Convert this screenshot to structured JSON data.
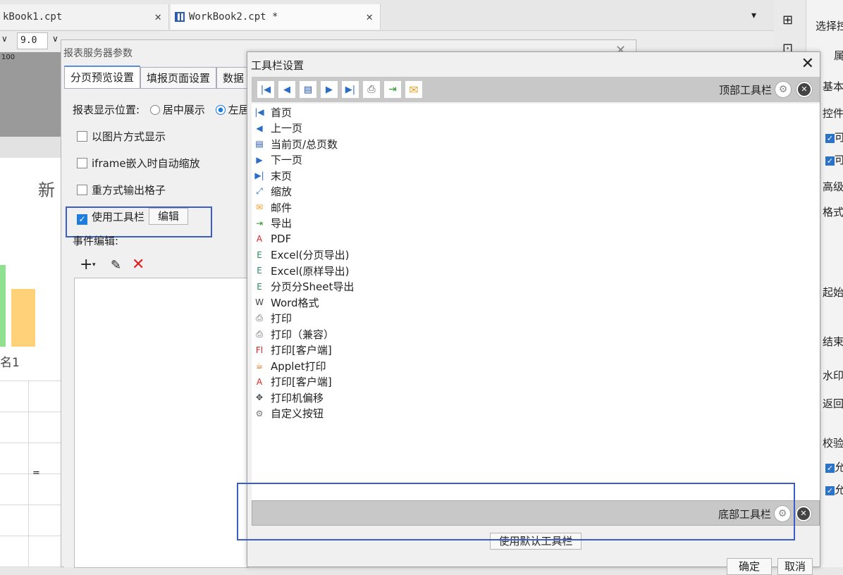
{
  "tabs": [
    {
      "label": "kBook1.cpt"
    },
    {
      "label": "WorkBook2.cpt *"
    }
  ],
  "ribbon": {
    "font_size": "9.0",
    "ruler": "100"
  },
  "right_panel": {
    "header": "选择控",
    "items": [
      "属",
      "基本",
      "控件",
      "可",
      "可",
      "高级",
      "格式",
      "起始",
      "结束",
      "水印",
      "返回",
      "校验",
      "允",
      "允"
    ]
  },
  "sheet": {
    "title_fragment": "新",
    "label": "名1",
    "cell": "="
  },
  "report_dialog": {
    "title": "报表服务器参数",
    "tabs": [
      "分页预览设置",
      "填报页面设置",
      "数据"
    ],
    "display_position_label": "报表显示位置:",
    "radio_center": "居中展示",
    "radio_left": "左居",
    "opt_image": "以图片方式显示",
    "opt_iframe": "iframe嵌入时自动缩放",
    "opt_repeat": "重方式输出格子",
    "opt_toolbar": "使用工具栏",
    "edit_button": "编辑",
    "event_label": "事件编辑:"
  },
  "toolbar_dialog": {
    "title": "工具栏设置",
    "top_toolbar": "顶部工具栏",
    "bottom_toolbar": "底部工具栏",
    "use_default": "使用默认工具栏",
    "ok": "确定",
    "cancel": "取消",
    "items": [
      {
        "label": "首页",
        "icon": "first-page-icon"
      },
      {
        "label": "上一页",
        "icon": "prev-page-icon"
      },
      {
        "label": "当前页/总页数",
        "icon": "page-count-icon"
      },
      {
        "label": "下一页",
        "icon": "next-page-icon"
      },
      {
        "label": "末页",
        "icon": "last-page-icon"
      },
      {
        "label": "缩放",
        "icon": "zoom-icon"
      },
      {
        "label": "邮件",
        "icon": "mail-icon"
      },
      {
        "label": "导出",
        "icon": "export-icon"
      },
      {
        "label": "PDF",
        "icon": "pdf-icon"
      },
      {
        "label": "Excel(分页导出)",
        "icon": "excel-icon"
      },
      {
        "label": "Excel(原样导出)",
        "icon": "excel-icon"
      },
      {
        "label": "分页分Sheet导出",
        "icon": "excel-icon"
      },
      {
        "label": "Word格式",
        "icon": "word-icon"
      },
      {
        "label": "打印",
        "icon": "print-icon"
      },
      {
        "label": "打印（兼容）",
        "icon": "print-icon"
      },
      {
        "label": "打印[客户端]",
        "icon": "flash-print-icon"
      },
      {
        "label": "Applet打印",
        "icon": "applet-icon"
      },
      {
        "label": "打印[客户端]",
        "icon": "pdf-print-icon"
      },
      {
        "label": "打印机偏移",
        "icon": "move-icon"
      },
      {
        "label": "自定义按钮",
        "icon": "gear-icon"
      }
    ]
  }
}
